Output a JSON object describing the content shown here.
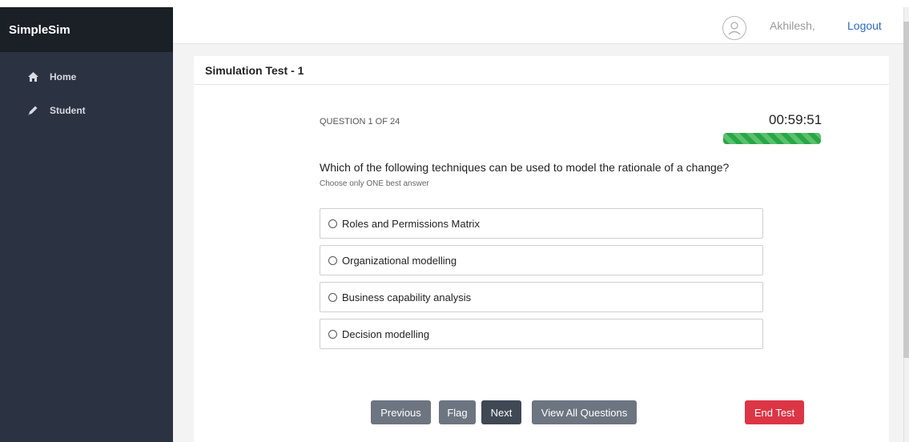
{
  "app": {
    "brand": "SimpleSim"
  },
  "sidebar": {
    "items": [
      {
        "label": "Home",
        "icon": "home-icon"
      },
      {
        "label": "Student",
        "icon": "pencil-icon"
      }
    ]
  },
  "header": {
    "username": "Akhilesh,",
    "logout_label": "Logout"
  },
  "card": {
    "title": "Simulation Test - 1"
  },
  "quiz": {
    "counter": "QUESTION 1 OF 24",
    "timer": "00:59:51",
    "progress": 1.0,
    "question": "Which of the following techniques can be used to model the rationale of a change?",
    "hint": "Choose only ONE best answer",
    "options": [
      "Roles and Permissions Matrix",
      "Organizational modelling",
      "Business capability analysis",
      "Decision modelling"
    ]
  },
  "buttons": {
    "previous": "Previous",
    "flag": "Flag",
    "next": "Next",
    "view_all": "View All Questions",
    "end_test": "End Test"
  },
  "colors": {
    "sidebar": "#2b3242",
    "brand_bar": "#1b1f26",
    "progress": "#28a745",
    "end_test": "#dc3545",
    "link": "#2b6cc4"
  }
}
